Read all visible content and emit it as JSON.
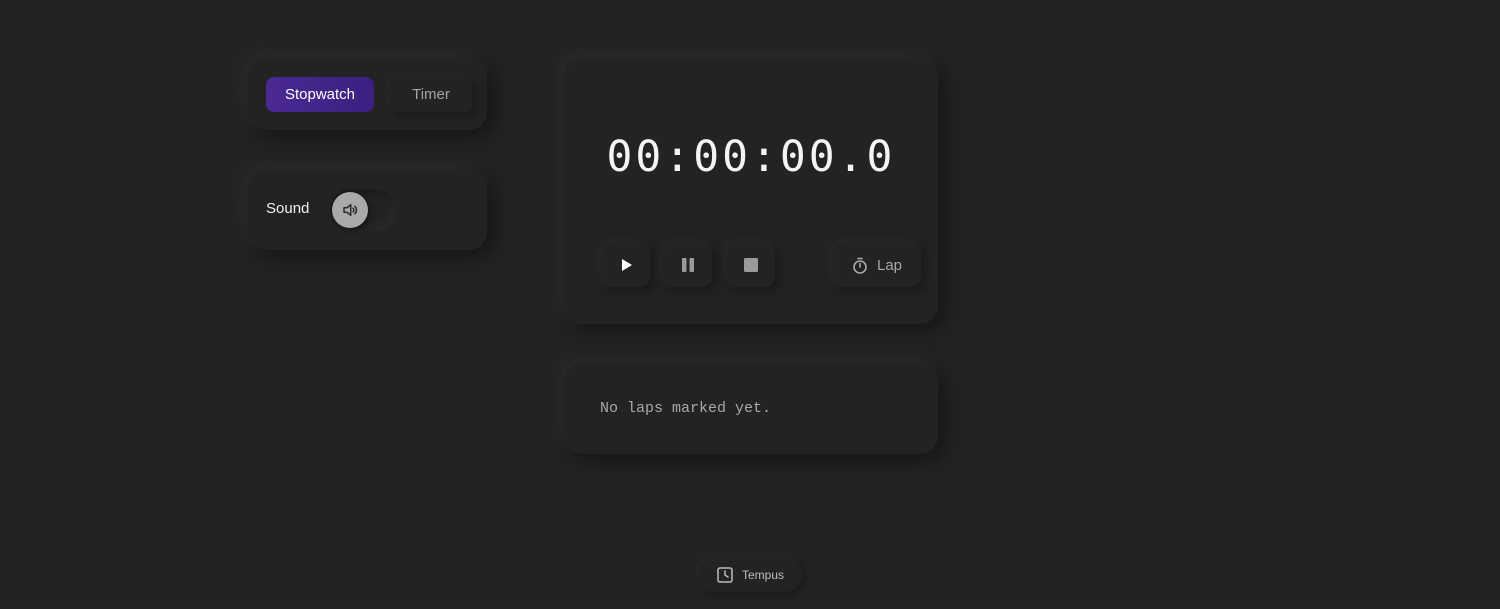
{
  "mode_switch": {
    "stopwatch_label": "Stopwatch",
    "timer_label": "Timer",
    "active": "Stopwatch"
  },
  "sound": {
    "label": "Sound",
    "icon": "speaker-icon",
    "enabled": true
  },
  "stopwatch": {
    "time": "00:00:00.0",
    "controls": {
      "play_icon": "play-icon",
      "pause_icon": "pause-icon",
      "stop_icon": "stop-icon",
      "lap_label": "Lap",
      "lap_icon": "stopwatch-icon"
    }
  },
  "laps": {
    "empty_message": "No laps marked yet."
  },
  "footer": {
    "brand": "Tempus",
    "brand_icon": "clock-icon"
  },
  "colors": {
    "background": "#232323",
    "accent": "#4a2a92",
    "text": "#f4f4f4",
    "muted_text": "#a8a8a8"
  }
}
